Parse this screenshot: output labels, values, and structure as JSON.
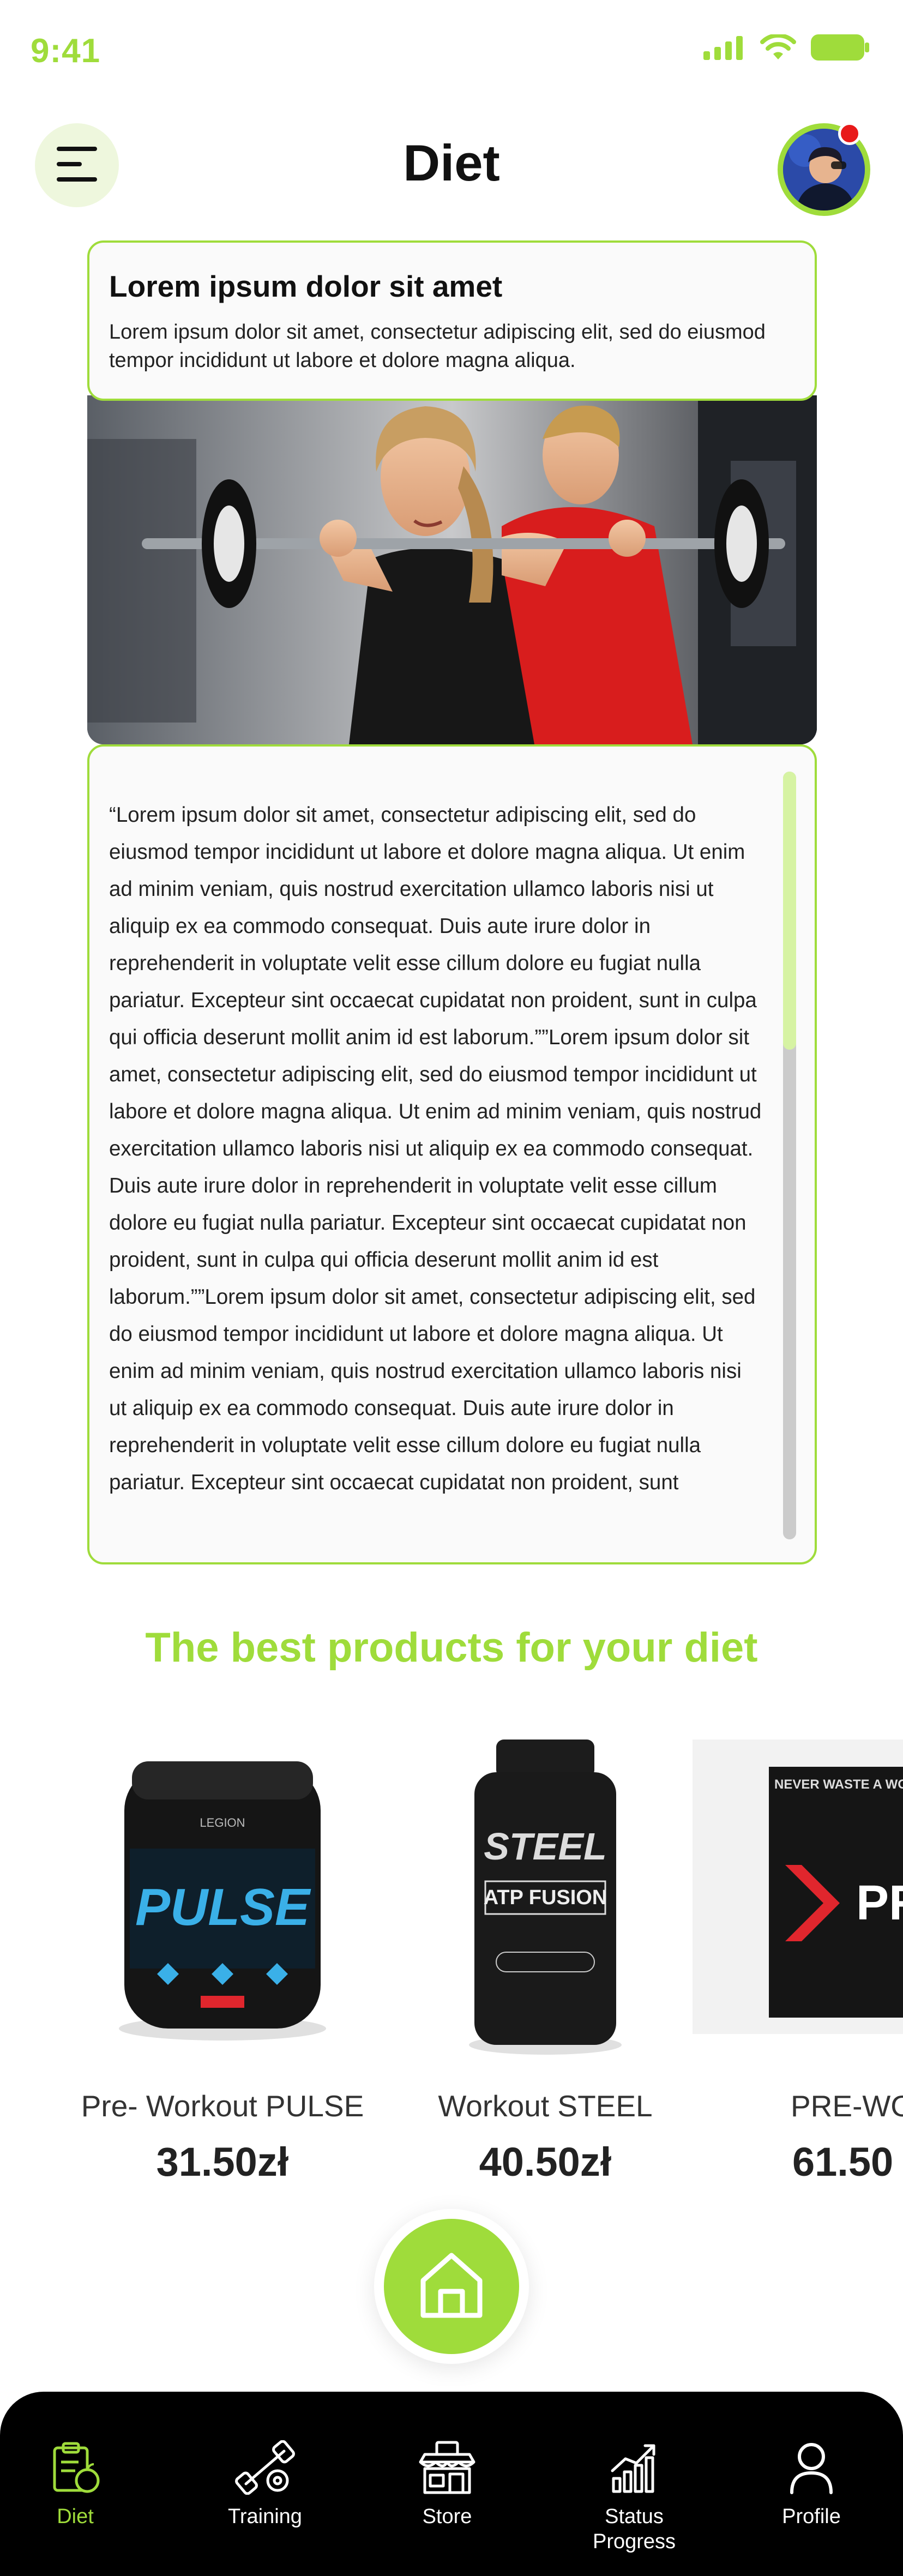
{
  "status_bar": {
    "time": "9:41",
    "accent": "#9fdc3b"
  },
  "header": {
    "title": "Diet",
    "menu_icon": "menu-icon",
    "avatar_badge_color": "#e81a1a"
  },
  "intro": {
    "title": "Lorem ipsum dolor sit amet",
    "text": "Lorem ipsum dolor sit amet, consectetur adipiscing elit, sed do eiusmod tempor incididunt ut labore et dolore magna aliqua."
  },
  "article": {
    "text": "“Lorem ipsum dolor sit amet, consectetur adipiscing elit, sed do eiusmod tempor incididunt ut labore et dolore magna aliqua. Ut enim ad minim veniam, quis nostrud exercitation ullamco laboris nisi ut aliquip ex ea commodo consequat. Duis aute irure dolor in reprehenderit in voluptate velit esse cillum dolore eu fugiat nulla pariatur. Excepteur sint occaecat cupidatat non proident, sunt in culpa qui officia deserunt mollit anim id est laborum.””Lorem ipsum dolor sit amet, consectetur adipiscing elit, sed do eiusmod tempor incididunt ut labore et dolore magna aliqua. Ut enim ad minim veniam, quis nostrud exercitation ullamco laboris nisi ut aliquip ex ea commodo consequat. Duis aute irure dolor in reprehenderit in voluptate velit esse cillum dolore eu fugiat nulla pariatur. Excepteur sint occaecat cupidatat non proident, sunt in culpa qui officia deserunt mollit anim id est laborum.””Lorem ipsum dolor sit amet, consectetur adipiscing elit, sed do eiusmod tempor incididunt ut labore et dolore magna aliqua. Ut enim ad minim veniam, quis nostrud exercitation ullamco laboris nisi ut aliquip ex ea commodo consequat. Duis aute irure dolor in reprehenderit in voluptate velit esse cillum dolore eu fugiat nulla pariatur. Excepteur sint occaecat cupidatat non proident, sunt"
  },
  "products": {
    "title": "The best products for your diet",
    "items": [
      {
        "name": "Pre- Workout PULSE",
        "price": "31.50zł",
        "label_text": "PULSE",
        "brand": "LEGION"
      },
      {
        "name": "Workout STEEL",
        "price": "40.50zł",
        "label_text": "STEEL",
        "sub_label": "ATP FUSION"
      },
      {
        "name": "PRE-WO",
        "price": "61.50",
        "label_text": "PR",
        "top_text": "NEVER WASTE A WORK"
      }
    ]
  },
  "fab": {
    "icon": "home-icon"
  },
  "nav": {
    "items": [
      {
        "label": "Diet",
        "icon": "diet-clipboard-icon",
        "active": true
      },
      {
        "label": "Training",
        "icon": "dumbbell-icon",
        "active": false
      },
      {
        "label": "Store",
        "icon": "store-icon",
        "active": false
      },
      {
        "label": "Status Progress",
        "icon": "chart-icon",
        "active": false
      },
      {
        "label": "Profile",
        "icon": "profile-icon",
        "active": false
      }
    ],
    "active_color": "#9fdc3b"
  }
}
